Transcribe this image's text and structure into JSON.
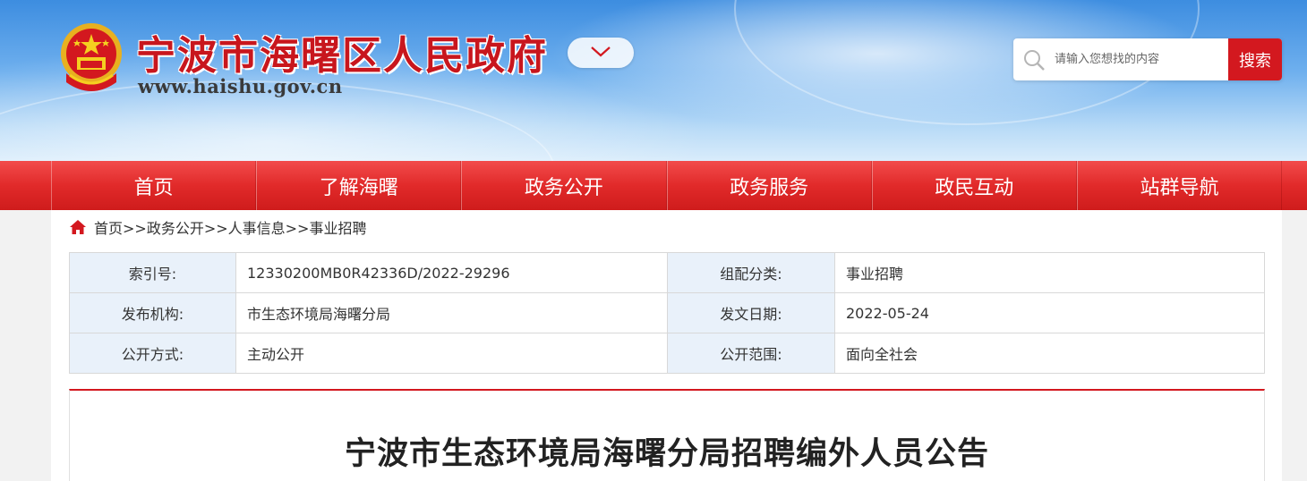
{
  "header": {
    "title": "宁波市海曙区人民政府",
    "url": "www.haishu.gov.cn",
    "search_placeholder": "请输入您想找的内容",
    "search_button": "搜索",
    "colors": {
      "brand_red": "#d3181f",
      "sky_blue": "#6fb0ee"
    }
  },
  "nav": {
    "items": [
      {
        "label": "首页"
      },
      {
        "label": "了解海曙"
      },
      {
        "label": "政务公开"
      },
      {
        "label": "政务服务"
      },
      {
        "label": "政民互动"
      },
      {
        "label": "站群导航"
      }
    ]
  },
  "breadcrumb": {
    "items": [
      "首页",
      "政务公开",
      "人事信息",
      "事业招聘"
    ],
    "separator": ">>",
    "text": "首页>>政务公开>>人事信息>>事业招聘"
  },
  "info": {
    "rows": [
      {
        "label1": "索引号:",
        "value1": "12330200MB0R42336D/2022-29296",
        "label2": "组配分类:",
        "value2": "事业招聘"
      },
      {
        "label1": "发布机构:",
        "value1": "市生态环境局海曙分局",
        "label2": "发文日期:",
        "value2": "2022-05-24"
      },
      {
        "label1": "公开方式:",
        "value1": "主动公开",
        "label2": "公开范围:",
        "value2": "面向全社会"
      }
    ]
  },
  "article": {
    "title": "宁波市生态环境局海曙分局招聘编外人员公告"
  },
  "icons": {
    "emblem": "national-emblem-icon",
    "dropdown": "chevron-down-icon",
    "search": "search-icon",
    "home": "home-icon"
  }
}
